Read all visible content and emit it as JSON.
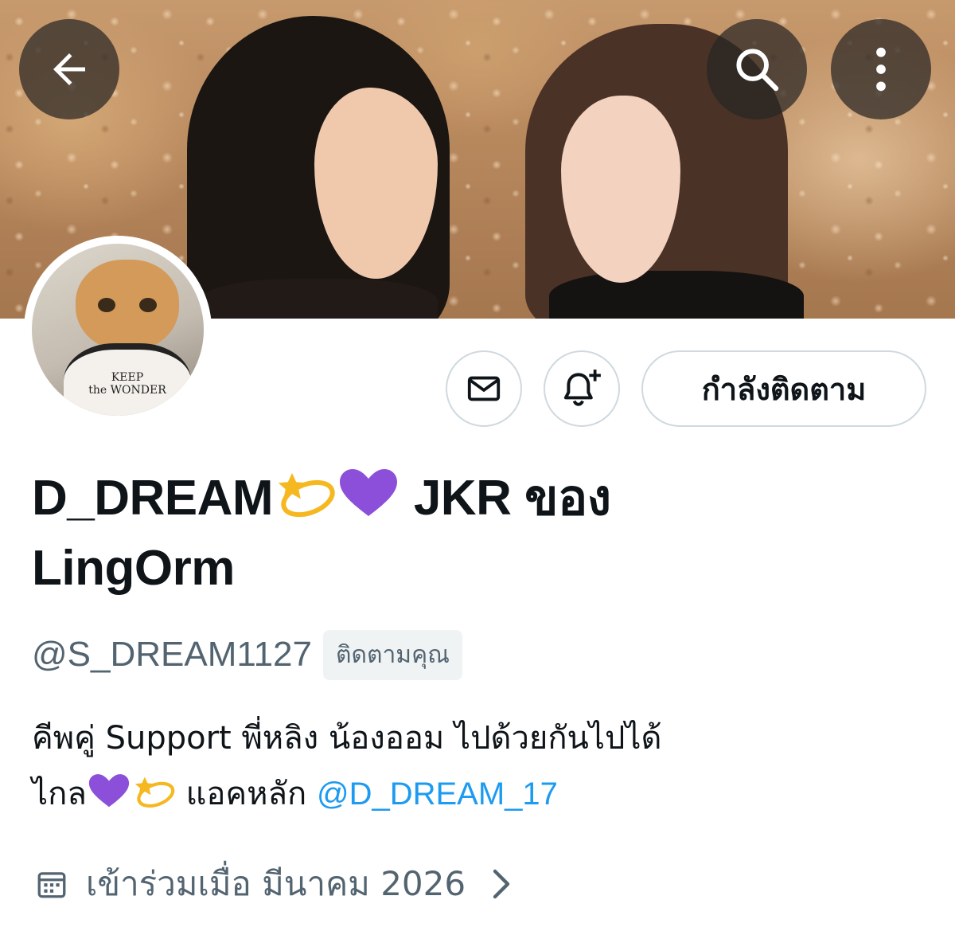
{
  "header": {
    "back_icon": "arrow-left-icon",
    "search_icon": "search-icon",
    "more_icon": "more-vertical-icon"
  },
  "avatar": {
    "shirt_line1": "KEEP",
    "shirt_line2": "the WONDER"
  },
  "actions": {
    "message_icon": "envelope-icon",
    "notify_icon": "bell-plus-icon",
    "follow_label": "กำลังติดตาม"
  },
  "profile": {
    "name_part1": "D_DREAM",
    "name_part2": "JKR ของ",
    "name_part3": "LingOrm",
    "handle": "@S_DREAM1127",
    "follows_you": "ติดตามคุณ",
    "bio_line1": "คีพคู่  Support พี่หลิง น้องออม  ไปด้วยกันไปได้",
    "bio_line2_prefix": "ไกล",
    "bio_line2_mid": "แอคหลัก",
    "bio_link": "@D_DREAM_17",
    "joined": "เข้าร่วมเมื่อ มีนาคม 2026"
  },
  "colors": {
    "link": "#1d9bf0",
    "secondary_text": "#536471",
    "border": "#cfd9de",
    "purple_heart": "#8c4fd9",
    "star": "#f5b820"
  }
}
